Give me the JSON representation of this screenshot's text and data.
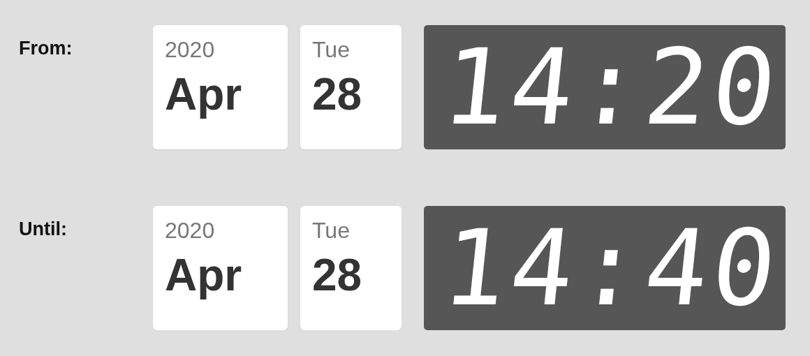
{
  "ranges": [
    {
      "label": "From:",
      "year": "2020",
      "month": "Apr",
      "weekday": "Tue",
      "day": "28",
      "time": "14:20"
    },
    {
      "label": "Until:",
      "year": "2020",
      "month": "Apr",
      "weekday": "Tue",
      "day": "28",
      "time": "14:40"
    }
  ]
}
